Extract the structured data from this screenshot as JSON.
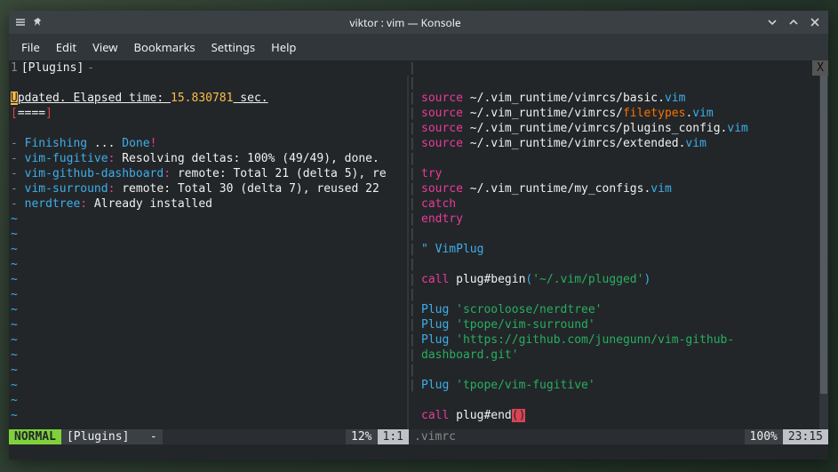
{
  "window": {
    "title": "viktor : vim — Konsole"
  },
  "menubar": [
    "File",
    "Edit",
    "View",
    "Bookmarks",
    "Settings",
    "Help"
  ],
  "tabline": {
    "num": "1",
    "label": "[Plugins]",
    "sep": "-",
    "close": "X"
  },
  "left": {
    "cursor": "U",
    "status_rest": "pdated. Elapsed time: ",
    "time": "15.830781",
    "sec": " sec.",
    "prog_l": "[",
    "prog_mid": "====",
    "prog_r": "]",
    "lines": [
      {
        "dash": "- ",
        "kw": "Finishing",
        "rest": " ... ",
        "done": "Done",
        "bang": "!"
      },
      {
        "dash": "- ",
        "kw": "vim-fugitive",
        "colon": ":",
        "rest": " Resolving deltas: 100% (49/49), done."
      },
      {
        "dash": "- ",
        "kw": "vim-github-dashboard",
        "colon": ":",
        "rest": " remote: Total 21 (delta 5), re"
      },
      {
        "dash": "- ",
        "kw": "vim-surround",
        "colon": ":",
        "rest": " remote: Total 30 (delta 7), reused 22"
      },
      {
        "dash": "- ",
        "kw": "nerdtree",
        "colon": ":",
        "rest": " Already installed"
      }
    ],
    "statusline": {
      "mode": "NORMAL",
      "file": "[Plugins]",
      "mod": "-",
      "pct": "12%",
      "pos": "1:1"
    }
  },
  "right": {
    "lines": [
      {
        "t": "src",
        "kw": "source",
        "p": " ~/.vim_runtime/vimrcs/basic.",
        "ext": "vim"
      },
      {
        "t": "src",
        "kw": "source",
        "p": " ~/.vim_runtime/vimrcs/",
        "mid": "filetypes",
        "dot": ".",
        "ext": "vim"
      },
      {
        "t": "src",
        "kw": "source",
        "p": " ~/.vim_runtime/vimrcs/plugins_config.",
        "ext": "vim"
      },
      {
        "t": "src",
        "kw": "source",
        "p": " ~/.vim_runtime/vimrcs/extended.",
        "ext": "vim"
      },
      {
        "t": "blank"
      },
      {
        "t": "kw",
        "kw": "try"
      },
      {
        "t": "src",
        "kw": "source",
        "p": " ~/.vim_runtime/my_configs.",
        "ext": "vim"
      },
      {
        "t": "kw",
        "kw": "catch"
      },
      {
        "t": "kw",
        "kw": "endtry"
      },
      {
        "t": "blank"
      },
      {
        "t": "comment",
        "c": "\" VimPlug"
      },
      {
        "t": "blank"
      },
      {
        "t": "call",
        "kw": "call",
        "fn": " plug#begin",
        "paren": "(",
        "str": "'~/.vim/plugged'",
        "close": ")"
      },
      {
        "t": "blank"
      },
      {
        "t": "plug",
        "kw": "Plug ",
        "str": "'scrooloose/nerdtree'"
      },
      {
        "t": "plug",
        "kw": "Plug ",
        "str": "'tpope/vim-surround'"
      },
      {
        "t": "plug",
        "kw": "Plug ",
        "str": "'https://github.com/junegunn/vim-github-"
      },
      {
        "t": "plugcont",
        "str": "dashboard.git'"
      },
      {
        "t": "blank"
      },
      {
        "t": "plug",
        "kw": "Plug ",
        "str": "'tpope/vim-fugitive'"
      },
      {
        "t": "blank"
      },
      {
        "t": "callend",
        "kw": "call",
        "fn": " plug#end",
        "paren": "(",
        "close": ")"
      }
    ],
    "statusline": {
      "file": ".vimrc",
      "pct": "100%",
      "pos": "23:15"
    }
  }
}
